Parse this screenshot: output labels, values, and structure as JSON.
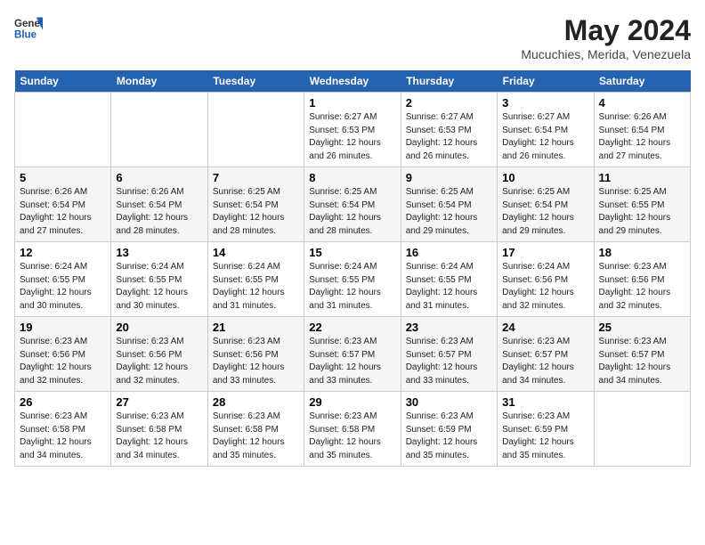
{
  "logo": {
    "general": "General",
    "blue": "Blue"
  },
  "header": {
    "month_year": "May 2024",
    "location": "Mucuchies, Merida, Venezuela"
  },
  "days_of_week": [
    "Sunday",
    "Monday",
    "Tuesday",
    "Wednesday",
    "Thursday",
    "Friday",
    "Saturday"
  ],
  "weeks": [
    [
      {
        "day": "",
        "info": ""
      },
      {
        "day": "",
        "info": ""
      },
      {
        "day": "",
        "info": ""
      },
      {
        "day": "1",
        "info": "Sunrise: 6:27 AM\nSunset: 6:53 PM\nDaylight: 12 hours\nand 26 minutes."
      },
      {
        "day": "2",
        "info": "Sunrise: 6:27 AM\nSunset: 6:53 PM\nDaylight: 12 hours\nand 26 minutes."
      },
      {
        "day": "3",
        "info": "Sunrise: 6:27 AM\nSunset: 6:54 PM\nDaylight: 12 hours\nand 26 minutes."
      },
      {
        "day": "4",
        "info": "Sunrise: 6:26 AM\nSunset: 6:54 PM\nDaylight: 12 hours\nand 27 minutes."
      }
    ],
    [
      {
        "day": "5",
        "info": "Sunrise: 6:26 AM\nSunset: 6:54 PM\nDaylight: 12 hours\nand 27 minutes."
      },
      {
        "day": "6",
        "info": "Sunrise: 6:26 AM\nSunset: 6:54 PM\nDaylight: 12 hours\nand 28 minutes."
      },
      {
        "day": "7",
        "info": "Sunrise: 6:25 AM\nSunset: 6:54 PM\nDaylight: 12 hours\nand 28 minutes."
      },
      {
        "day": "8",
        "info": "Sunrise: 6:25 AM\nSunset: 6:54 PM\nDaylight: 12 hours\nand 28 minutes."
      },
      {
        "day": "9",
        "info": "Sunrise: 6:25 AM\nSunset: 6:54 PM\nDaylight: 12 hours\nand 29 minutes."
      },
      {
        "day": "10",
        "info": "Sunrise: 6:25 AM\nSunset: 6:54 PM\nDaylight: 12 hours\nand 29 minutes."
      },
      {
        "day": "11",
        "info": "Sunrise: 6:25 AM\nSunset: 6:55 PM\nDaylight: 12 hours\nand 29 minutes."
      }
    ],
    [
      {
        "day": "12",
        "info": "Sunrise: 6:24 AM\nSunset: 6:55 PM\nDaylight: 12 hours\nand 30 minutes."
      },
      {
        "day": "13",
        "info": "Sunrise: 6:24 AM\nSunset: 6:55 PM\nDaylight: 12 hours\nand 30 minutes."
      },
      {
        "day": "14",
        "info": "Sunrise: 6:24 AM\nSunset: 6:55 PM\nDaylight: 12 hours\nand 31 minutes."
      },
      {
        "day": "15",
        "info": "Sunrise: 6:24 AM\nSunset: 6:55 PM\nDaylight: 12 hours\nand 31 minutes."
      },
      {
        "day": "16",
        "info": "Sunrise: 6:24 AM\nSunset: 6:55 PM\nDaylight: 12 hours\nand 31 minutes."
      },
      {
        "day": "17",
        "info": "Sunrise: 6:24 AM\nSunset: 6:56 PM\nDaylight: 12 hours\nand 32 minutes."
      },
      {
        "day": "18",
        "info": "Sunrise: 6:23 AM\nSunset: 6:56 PM\nDaylight: 12 hours\nand 32 minutes."
      }
    ],
    [
      {
        "day": "19",
        "info": "Sunrise: 6:23 AM\nSunset: 6:56 PM\nDaylight: 12 hours\nand 32 minutes."
      },
      {
        "day": "20",
        "info": "Sunrise: 6:23 AM\nSunset: 6:56 PM\nDaylight: 12 hours\nand 32 minutes."
      },
      {
        "day": "21",
        "info": "Sunrise: 6:23 AM\nSunset: 6:56 PM\nDaylight: 12 hours\nand 33 minutes."
      },
      {
        "day": "22",
        "info": "Sunrise: 6:23 AM\nSunset: 6:57 PM\nDaylight: 12 hours\nand 33 minutes."
      },
      {
        "day": "23",
        "info": "Sunrise: 6:23 AM\nSunset: 6:57 PM\nDaylight: 12 hours\nand 33 minutes."
      },
      {
        "day": "24",
        "info": "Sunrise: 6:23 AM\nSunset: 6:57 PM\nDaylight: 12 hours\nand 34 minutes."
      },
      {
        "day": "25",
        "info": "Sunrise: 6:23 AM\nSunset: 6:57 PM\nDaylight: 12 hours\nand 34 minutes."
      }
    ],
    [
      {
        "day": "26",
        "info": "Sunrise: 6:23 AM\nSunset: 6:58 PM\nDaylight: 12 hours\nand 34 minutes."
      },
      {
        "day": "27",
        "info": "Sunrise: 6:23 AM\nSunset: 6:58 PM\nDaylight: 12 hours\nand 34 minutes."
      },
      {
        "day": "28",
        "info": "Sunrise: 6:23 AM\nSunset: 6:58 PM\nDaylight: 12 hours\nand 35 minutes."
      },
      {
        "day": "29",
        "info": "Sunrise: 6:23 AM\nSunset: 6:58 PM\nDaylight: 12 hours\nand 35 minutes."
      },
      {
        "day": "30",
        "info": "Sunrise: 6:23 AM\nSunset: 6:59 PM\nDaylight: 12 hours\nand 35 minutes."
      },
      {
        "day": "31",
        "info": "Sunrise: 6:23 AM\nSunset: 6:59 PM\nDaylight: 12 hours\nand 35 minutes."
      },
      {
        "day": "",
        "info": ""
      }
    ]
  ]
}
